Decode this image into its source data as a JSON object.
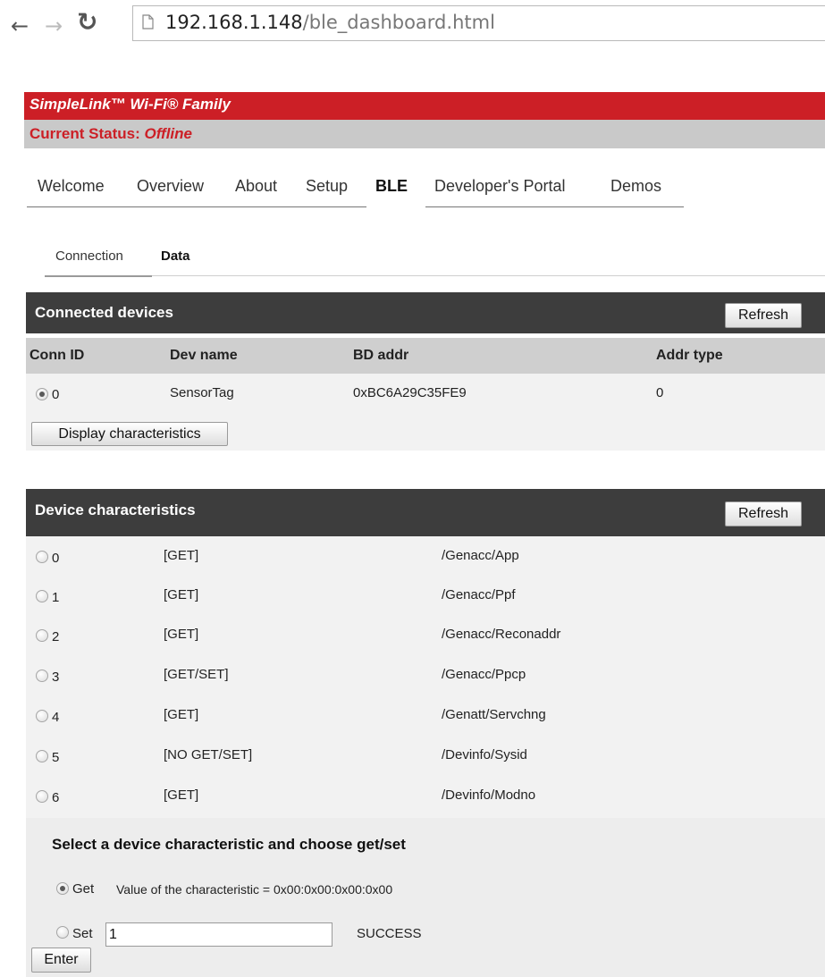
{
  "browser": {
    "url_host": "192.168.1.148",
    "url_path": "/ble_dashboard.html"
  },
  "brand": {
    "title": "SimpleLink™ Wi-Fi® Family",
    "status_label": "Current Status:",
    "status_value": "Offline",
    "accent_color": "#cc1f26"
  },
  "nav": {
    "items": [
      "Welcome",
      "Overview",
      "About",
      "Setup",
      "BLE",
      "Developer's Portal",
      "Demos"
    ],
    "active": "BLE"
  },
  "subnav": {
    "items": [
      "Connection",
      "Data"
    ],
    "active": "Data"
  },
  "connected": {
    "title": "Connected devices",
    "refresh_label": "Refresh",
    "columns": [
      "Conn ID",
      "Dev name",
      "BD addr",
      "Addr type"
    ],
    "rows": [
      {
        "conn_id": "0",
        "dev_name": "SensorTag",
        "bd_addr": "0xBC6A29C35FE9",
        "addr_type": "0",
        "selected": true
      }
    ],
    "display_button": "Display characteristics"
  },
  "characteristics": {
    "title": "Device characteristics",
    "refresh_label": "Refresh",
    "rows": [
      {
        "id": "0",
        "mode": "[GET]",
        "path": "/Genacc/App"
      },
      {
        "id": "1",
        "mode": "[GET]",
        "path": "/Genacc/Ppf"
      },
      {
        "id": "2",
        "mode": "[GET]",
        "path": "/Genacc/Reconaddr"
      },
      {
        "id": "3",
        "mode": "[GET/SET]",
        "path": "/Genacc/Ppcp"
      },
      {
        "id": "4",
        "mode": "[GET]",
        "path": "/Genatt/Servchng"
      },
      {
        "id": "5",
        "mode": "[NO GET/SET]",
        "path": "/Devinfo/Sysid"
      },
      {
        "id": "6",
        "mode": "[GET]",
        "path": "/Devinfo/Modno"
      }
    ]
  },
  "getset": {
    "title": "Select a device characteristic and choose get/set",
    "get_label": "Get",
    "get_value_text": "Value of the characteristic = 0x00:0x00:0x00:0x00",
    "set_label": "Set",
    "set_value": "1",
    "result_text": "SUCCESS",
    "enter_label": "Enter",
    "selected": "Get"
  }
}
